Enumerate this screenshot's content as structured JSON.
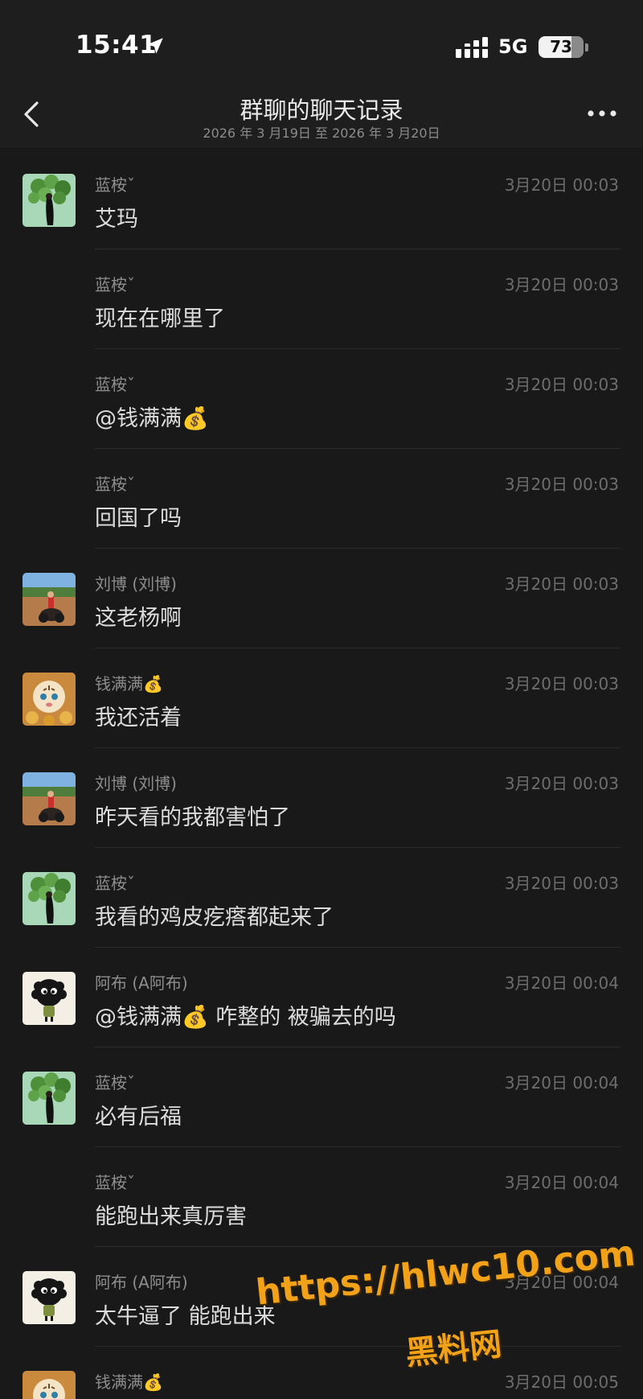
{
  "status_bar": {
    "time": "15:41",
    "location_icon": "location-arrow-icon",
    "signal_icon": "cellular-signal-icon",
    "network": "5G",
    "battery": "73",
    "battery_level_percent": 73
  },
  "nav": {
    "back_icon": "chevron-left-icon",
    "title": "群聊的聊天记录",
    "subtitle": "2026 年 3 月19日 至 2026 年 3 月20日",
    "more_icon": "more-dots-icon"
  },
  "messages": [
    {
      "sender": "蓝桉ˇ",
      "time": "3月20日 00:03",
      "text": "艾玛",
      "avatar": "plant-avatar"
    },
    {
      "sender": "蓝桉ˇ",
      "time": "3月20日 00:03",
      "text": "现在在哪里了",
      "avatar": ""
    },
    {
      "sender": "蓝桉ˇ",
      "time": "3月20日 00:03",
      "text": "@钱满满💰",
      "avatar": ""
    },
    {
      "sender": "蓝桉ˇ",
      "time": "3月20日 00:03",
      "text": "回国了吗",
      "avatar": ""
    },
    {
      "sender": "刘博 (刘博)",
      "time": "3月20日 00:03",
      "text": "这老杨啊",
      "avatar": "rider-avatar"
    },
    {
      "sender": "钱满满💰",
      "time": "3月20日 00:03",
      "text": "我还活着",
      "avatar": "tiger-avatar"
    },
    {
      "sender": "刘博 (刘博)",
      "time": "3月20日 00:03",
      "text": "昨天看的我都害怕了",
      "avatar": "rider-avatar"
    },
    {
      "sender": "蓝桉ˇ",
      "time": "3月20日 00:03",
      "text": "我看的鸡皮疙瘩都起来了",
      "avatar": "plant-avatar"
    },
    {
      "sender": "阿布 (A阿布)",
      "time": "3月20日 00:04",
      "text": "@钱满满💰 咋整的 被骗去的吗",
      "avatar": "fuzzball-avatar"
    },
    {
      "sender": "蓝桉ˇ",
      "time": "3月20日 00:04",
      "text": "必有后福",
      "avatar": "plant-avatar"
    },
    {
      "sender": "蓝桉ˇ",
      "time": "3月20日 00:04",
      "text": "能跑出来真厉害",
      "avatar": ""
    },
    {
      "sender": "阿布 (A阿布)",
      "time": "3月20日 00:04",
      "text": "太牛逼了 能跑出来",
      "avatar": "fuzzball-avatar"
    },
    {
      "sender": "钱满满💰",
      "time": "3月20日 00:05",
      "text": "",
      "avatar": "tiger-avatar"
    }
  ],
  "watermark": {
    "url": "https://hlwc10.com",
    "name": "黑料网"
  },
  "colors": {
    "background": "#191919",
    "header": "#1e1e1e",
    "watermark": "#f2a218"
  }
}
